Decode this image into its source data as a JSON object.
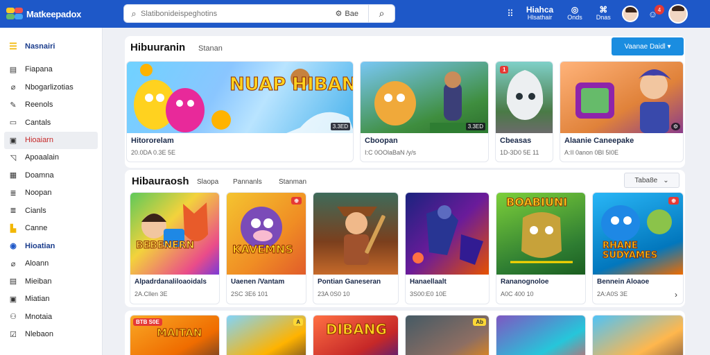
{
  "topbar": {
    "brand": "Matkeepadox",
    "search_placeholder": "Slatibonideispeghotins",
    "search_filter": "Bae",
    "right": [
      {
        "glyph": "Hiahca",
        "label": "Hlsathair"
      },
      {
        "glyph": "◎",
        "label": "Onds"
      },
      {
        "glyph": "⌘",
        "label": "Dnas"
      }
    ],
    "notification_count": "4",
    "colors": {
      "bar": "#1e58c8",
      "accent": "#1a8de0",
      "badge": "#e53935"
    }
  },
  "sidebar": {
    "sections": [
      {
        "label": "Nasnairi",
        "icon": "menu-icon",
        "kind": "section"
      },
      {
        "label": "Fiapana",
        "icon": "calendar-icon"
      },
      {
        "label": "Nbogarlizotias",
        "icon": "tag-icon"
      },
      {
        "label": "Reenols",
        "icon": "edit-icon"
      },
      {
        "label": "Cantals",
        "icon": "monitor-icon"
      },
      {
        "label": "Hioaiarn",
        "icon": "board-icon",
        "kind": "active"
      },
      {
        "label": "Apoaalain",
        "icon": "edit-icon"
      },
      {
        "label": "Doamna",
        "icon": "calendar-icon"
      },
      {
        "label": "Noopan",
        "icon": "list-icon"
      },
      {
        "label": "Cianls",
        "icon": "list-icon"
      },
      {
        "label": "Canne",
        "icon": "board-icon"
      },
      {
        "label": "Hioatian",
        "icon": "globe-icon",
        "kind": "section"
      },
      {
        "label": "Aloann",
        "icon": "edit-icon"
      },
      {
        "label": "Mieiban",
        "icon": "calendar-icon"
      },
      {
        "label": "Miatian",
        "icon": "board-icon"
      },
      {
        "label": "Mnotaia",
        "icon": "user-icon"
      },
      {
        "label": "Nlebaon",
        "icon": "check-icon"
      }
    ]
  },
  "featured": {
    "title": "Hibuuranin",
    "subtitle": "Stanan",
    "button": "Vaanae Daidl ▾",
    "cards": [
      {
        "title": "Hitororelam",
        "meta": "20.0DA 0.3E 5E",
        "badge": "3.3ED",
        "art": "NUAP HIBANG"
      },
      {
        "title": "Cboopan",
        "meta": "I:C 0OOlaBaN /y/s",
        "badge": "3.3ED",
        "art": ""
      },
      {
        "title": "Cbeasas",
        "meta": "1D-3D0 5E 11",
        "badge": "1",
        "art": ""
      },
      {
        "title": "Alaanie Caneepake",
        "meta": "A:II 0anon 0BI 5I0E",
        "badge": "⚙",
        "art": ""
      }
    ]
  },
  "popular": {
    "title": "Hibauraosh",
    "tabs": [
      "Slaopa",
      "Pannanls",
      "Stanman"
    ],
    "sort": "Taba8e",
    "cards": [
      {
        "title": "Alpadrdanaliloaoidals",
        "meta": "2A.Cllen 3E",
        "art": "BEBENERN"
      },
      {
        "title": "Uaenen /Vantam",
        "meta": "2SC 3E6 101",
        "art": "KAVEMNS",
        "tag": "⊕"
      },
      {
        "title": "Pontian Ganeseran",
        "meta": "23A 0S0 10",
        "art": ""
      },
      {
        "title": "Hanaellaalt",
        "meta": "3S00:E0 10E",
        "art": ""
      },
      {
        "title": "Rananognoloe",
        "meta": "A0C 400 10",
        "art": "BOABIUNI"
      },
      {
        "title": "Bennein Aloaoe",
        "meta": "2A:A0S 3E",
        "art": "RHANE SUDYAMES",
        "tag": "⊕"
      }
    ]
  },
  "more": {
    "cards": [
      {
        "art": "MAITAN",
        "tag": "BTB S0E"
      },
      {
        "art": "",
        "tag": "A"
      },
      {
        "art": "DIBANG"
      },
      {
        "art": "",
        "tag": "Ab"
      },
      {
        "art": ""
      },
      {
        "art": ""
      }
    ]
  }
}
